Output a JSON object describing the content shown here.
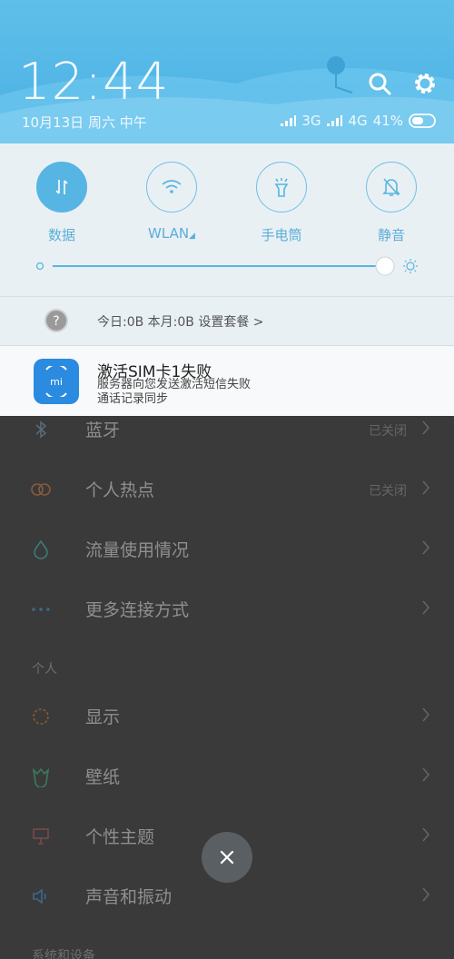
{
  "status_bar": {
    "time": "12:44",
    "date": "10月13日 周六 中午",
    "network_1": "3G",
    "network_2": "4G",
    "battery": "41%"
  },
  "toggles": [
    {
      "label": "数据",
      "icon": "data-transfer-icon",
      "active": true
    },
    {
      "label": "WLAN",
      "icon": "wifi-icon",
      "active": false
    },
    {
      "label": "手电筒",
      "icon": "flashlight-icon",
      "active": false
    },
    {
      "label": "静音",
      "icon": "bell-mute-icon",
      "active": false
    }
  ],
  "brightness": {
    "value": 0.93
  },
  "data_usage": {
    "text": "今日:0B  本月:0B  设置套餐 >"
  },
  "notification": {
    "title": "激活SIM卡1失败",
    "line1": "服务器向您发送激活短信失败",
    "line2": "通话记录同步",
    "app_icon": "mi-icon"
  },
  "settings": {
    "rows": [
      {
        "label": "蓝牙",
        "value": "已关闭",
        "icon": "bluetooth-icon"
      },
      {
        "label": "个人热点",
        "value": "已关闭",
        "icon": "hotspot-icon"
      },
      {
        "label": "流量使用情况",
        "value": "",
        "icon": "data-drop-icon"
      },
      {
        "label": "更多连接方式",
        "value": "",
        "icon": "more-dots-icon"
      }
    ],
    "section_personal": "个人",
    "rows2": [
      {
        "label": "显示",
        "icon": "display-icon"
      },
      {
        "label": "壁纸",
        "icon": "wallpaper-icon"
      },
      {
        "label": "个性主题",
        "icon": "theme-icon"
      },
      {
        "label": "声音和振动",
        "icon": "sound-icon"
      }
    ],
    "section_system": "系统和设备"
  },
  "colors": {
    "accent": "#56b5e2",
    "header": "#5fbfea",
    "panel": "#e9f0f4"
  }
}
